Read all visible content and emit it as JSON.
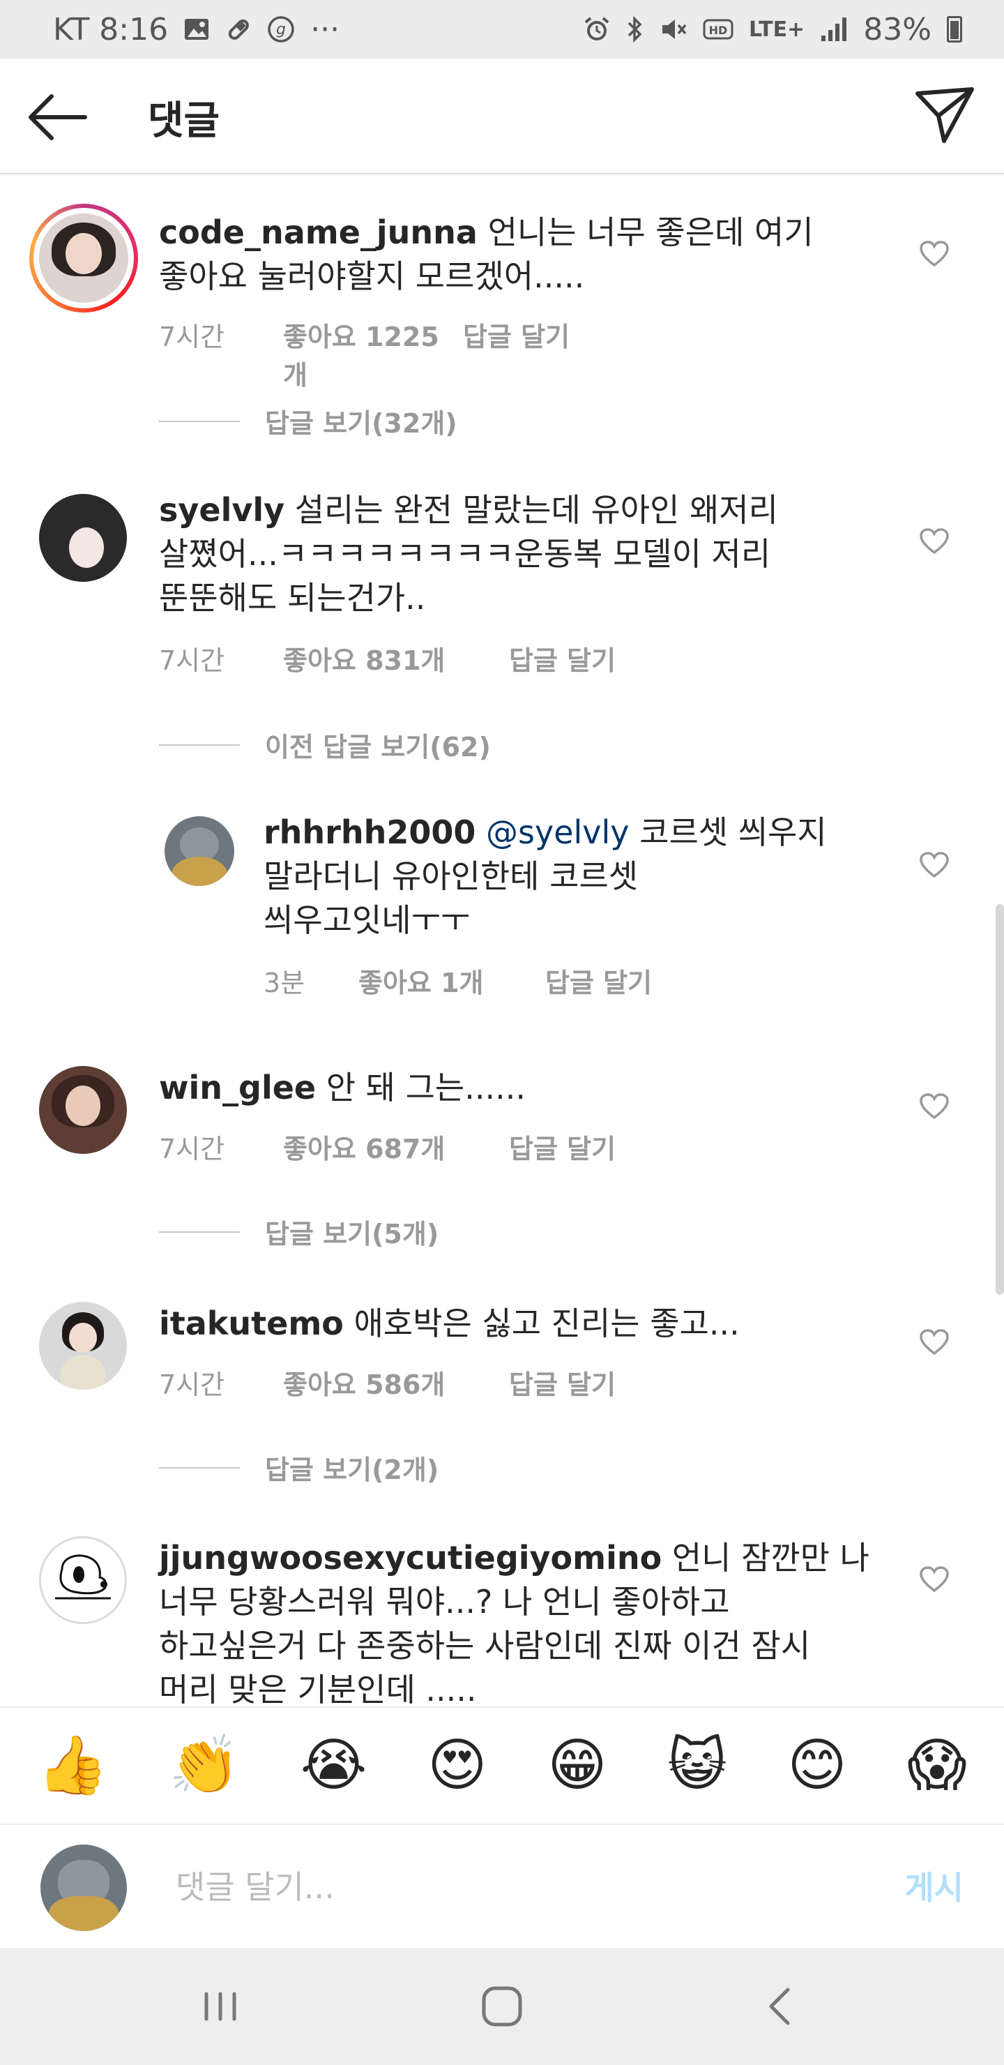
{
  "status_bar": {
    "carrier_time": "KT 8:16",
    "dots": "···",
    "network": "LTE+",
    "battery": "83%"
  },
  "header": {
    "title": "댓글"
  },
  "comments": [
    {
      "username": "code_name_junna",
      "text": "언니는 너무 좋은데 여기 좋아요 눌러야할지 모르겠어.....",
      "line1": " 언니는 너무 좋은데 여기",
      "line2": "좋아요 눌러야할지 모르겠어.....",
      "time": "7시간",
      "likes": "좋아요 1225개",
      "reply": "답글 달기",
      "view_replies": "답글 보기(32개)"
    },
    {
      "username": "syelvly",
      "line1": " 설리는 완전 말랐는데 유아인 왜저리",
      "line2": "살쪘어...ㅋㅋㅋㅋㅋㅋㅋㅋ운동복 모델이 저리",
      "line3": "뚠뚠해도 되는건가..",
      "time": "7시간",
      "likes": "좋아요 831개",
      "reply": "답글 달기",
      "view_replies": "이전 답글 보기(62)",
      "replies": [
        {
          "username": "rhhrhh2000",
          "mention": "@syelvly",
          "line1": " 코르셋 씌우지",
          "line2": "말라더니 유아인한테 코르셋",
          "line3": "씌우고잇네ㅜㅜ",
          "time": "3분",
          "likes": "좋아요 1개",
          "reply": "답글 달기"
        }
      ]
    },
    {
      "username": "win_glee",
      "line1": " 안 돼 그는......",
      "time": "7시간",
      "likes": "좋아요 687개",
      "reply": "답글 달기",
      "view_replies": "답글 보기(5개)"
    },
    {
      "username": "itakutemo",
      "line1": " 애호박은 싫고 진리는 좋고...",
      "time": "7시간",
      "likes": "좋아요 586개",
      "reply": "답글 달기",
      "view_replies": "답글 보기(2개)"
    },
    {
      "username": "jjungwoosexycutiegiyomino",
      "line1": " 언니 잠깐만 나",
      "line2": "너무 당황스러워 뭐야...? 나 언니 좋아하고",
      "line3": "하고싶은거 다 존중하는 사람인데 진짜 이건 잠시",
      "line4": "머리 맞은 기분인데 ....."
    }
  ],
  "emoji_bar": [
    "👍",
    "👏",
    "😭",
    "😍",
    "😁",
    "😺",
    "😊",
    "😱"
  ],
  "input": {
    "placeholder": "댓글 달기...",
    "post_label": "게시"
  },
  "colors": {
    "text": "#262626",
    "meta": "#999999",
    "mention": "#003569",
    "post_disabled": "#b2dffc",
    "divider": "#dbdbdb"
  }
}
